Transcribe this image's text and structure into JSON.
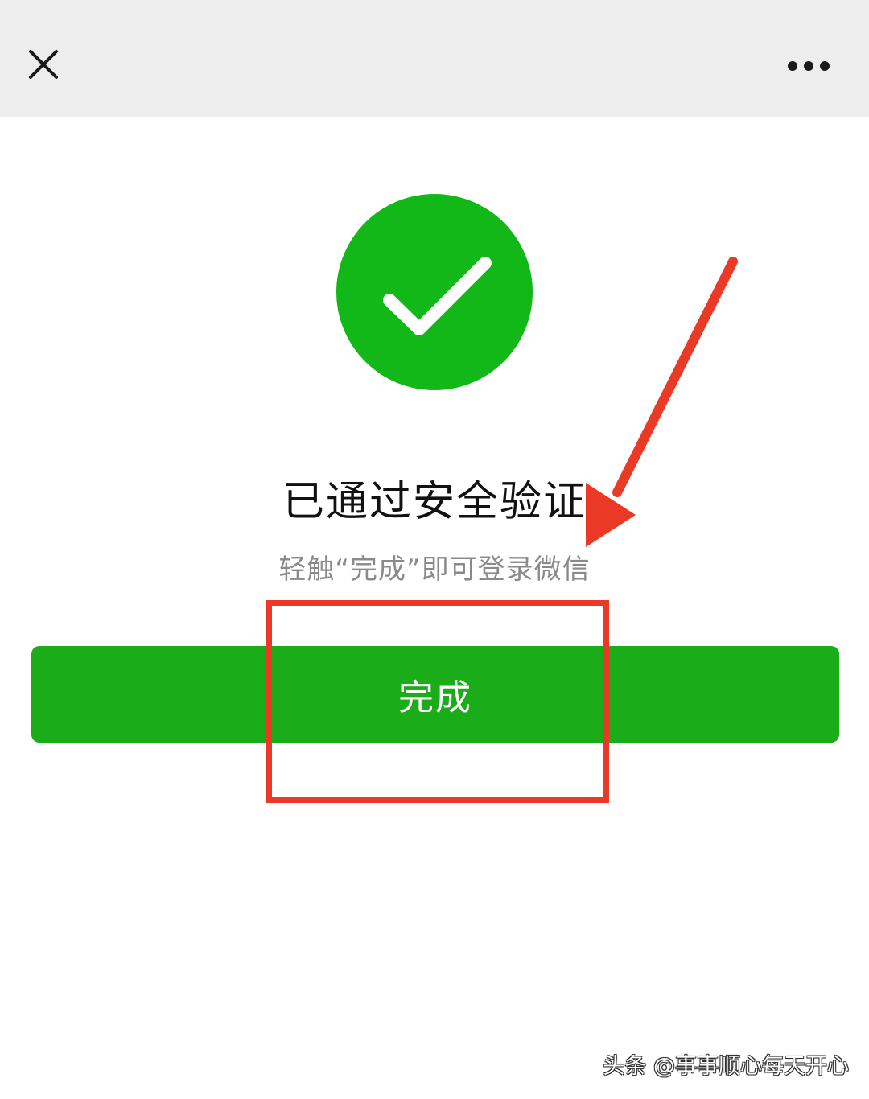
{
  "header": {
    "close_icon": "close-icon",
    "more_icon": "more-horizontal-icon"
  },
  "status": {
    "icon": "checkmark-circle-icon",
    "title": "已通过安全验证",
    "subtitle": "轻触“完成”即可登录微信"
  },
  "actions": {
    "done_label": "完成"
  },
  "watermark": {
    "text": "头条 @事事顺心每天开心"
  },
  "colors": {
    "header_bg": "#ededed",
    "success_green": "#11b817",
    "button_green": "#1aad19",
    "annotation_red": "#ea3a25"
  }
}
